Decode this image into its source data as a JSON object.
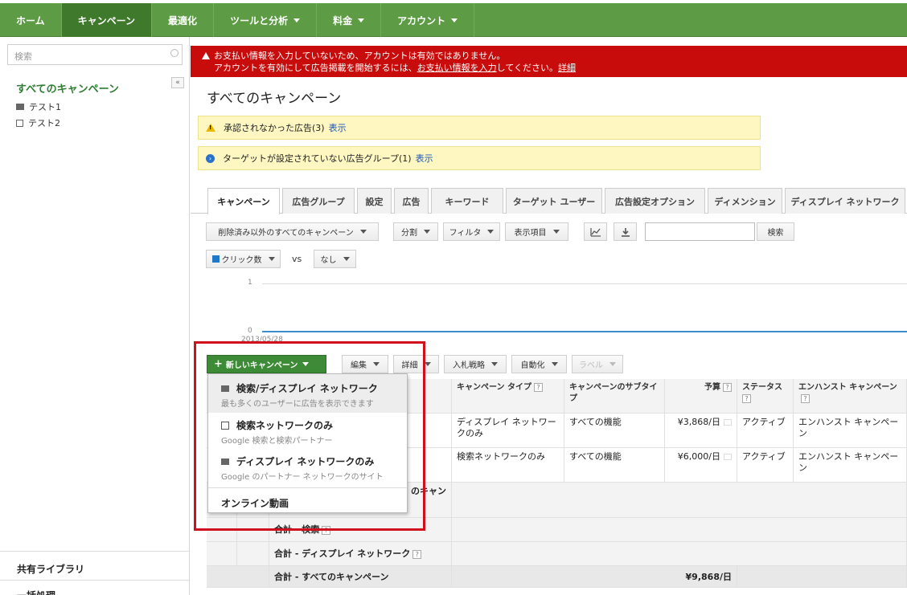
{
  "nav": {
    "items": [
      {
        "label": "ホーム",
        "dropdown": false,
        "active": false
      },
      {
        "label": "キャンペーン",
        "dropdown": false,
        "active": true
      },
      {
        "label": "最適化",
        "dropdown": false,
        "active": false
      },
      {
        "label": "ツールと分析",
        "dropdown": true,
        "active": false
      },
      {
        "label": "料金",
        "dropdown": true,
        "active": false
      },
      {
        "label": "アカウント",
        "dropdown": true,
        "active": false
      }
    ]
  },
  "sidebar": {
    "search_placeholder": "検索",
    "all_campaigns": "すべてのキャンペーン",
    "collapse_label": "«",
    "campaigns": [
      {
        "name": "テスト1",
        "icon": "display-campaign-icon"
      },
      {
        "name": "テスト2",
        "icon": "search-campaign-icon"
      }
    ],
    "shared_library": "共有ライブラリ",
    "bulk_operations": "一括処理"
  },
  "alert": {
    "line1": "お支払い情報を入力していないため、アカウントは有効ではありません。",
    "line2_prefix": "アカウントを有効にして広告掲載を開始するには、",
    "line2_link": "お支払い情報を入力",
    "line2_suffix": "してください。",
    "details_link": "詳細"
  },
  "page_title": "すべてのキャンペーン",
  "notices": [
    {
      "text": "承認されなかった広告(3)",
      "link": "表示",
      "icon": "warning-icon"
    },
    {
      "text": "ターゲットが設定されていない広告グループ(1)",
      "link": "表示",
      "icon": "info-icon"
    }
  ],
  "tabs": [
    {
      "label": "キャンペーン",
      "active": true
    },
    {
      "label": "広告グループ",
      "active": false
    },
    {
      "label": "設定",
      "active": false
    },
    {
      "label": "広告",
      "active": false
    },
    {
      "label": "キーワード",
      "active": false
    },
    {
      "label": "ターゲット ユーザー",
      "active": false
    },
    {
      "label": "広告設定オプション",
      "active": false
    },
    {
      "label": "ディメンション",
      "active": false
    },
    {
      "label": "ディスプレイ ネットワーク",
      "active": false
    }
  ],
  "toolbar": {
    "filter_all": "削除済み以外のすべてのキャンペーン",
    "segment": "分割",
    "filter": "フィルタ",
    "columns": "表示項目",
    "search_button": "検索"
  },
  "chart_controls": {
    "metric1": "クリック数",
    "vs": "vs",
    "metric2": "なし"
  },
  "chart": {
    "y_top": "1",
    "y_bottom": "0",
    "x_label": "2013/05/28",
    "line_color": "#3a8ccb"
  },
  "action_bar": {
    "new_campaign": "新しいキャンペーン",
    "edit": "編集",
    "details": "詳細",
    "bid_strategy": "入札戦略",
    "automate": "自動化",
    "labels": "ラベル"
  },
  "menu": {
    "items": [
      {
        "title": "検索/ディスプレイ ネットワーク",
        "subtitle": "最も多くのユーザーに広告を表示できます"
      },
      {
        "title": "検索ネットワークのみ",
        "subtitle": "Google 検索と検索パートナー"
      },
      {
        "title": "ディスプレイ ネットワークのみ",
        "subtitle": "Google のパートナー ネットワークのサイト"
      },
      {
        "title": "オンライン動画",
        "subtitle": ""
      }
    ]
  },
  "table": {
    "headers": {
      "campaign_type": "キャンペーン タイプ",
      "subtype": "キャンペーンのサブタイプ",
      "budget": "予算",
      "status": "ステータス",
      "enhanced": "エンハンスト キャンペーン"
    },
    "rows": [
      {
        "campaign_type": "ディスプレイ ネットワークのみ",
        "subtype": "すべての機能",
        "budget": "¥3,868/日",
        "status": "アクティブ",
        "enhanced": "エンハンスト キャンペーン"
      },
      {
        "campaign_type": "検索ネットワークのみ",
        "subtype": "すべての機能",
        "budget": "¥6,000/日",
        "status": "アクティブ",
        "enhanced": "エンハンスト キャンペーン"
      }
    ],
    "totals": {
      "partial_label": "のキャン",
      "search": "合計 - 検索",
      "display": "合計 - ディスプレイ ネットワーク",
      "all": "合計 - すべてのキャンペーン",
      "all_budget": "¥9,868/日"
    }
  },
  "colors": {
    "nav_bg": "#5d9b45",
    "nav_active": "#3f7a2c",
    "alert_bg": "#c80b0b",
    "notice_bg": "#fff7c2",
    "link": "#1b55b6",
    "primary_button": "#3d8b37",
    "highlight": "#d0101c"
  }
}
